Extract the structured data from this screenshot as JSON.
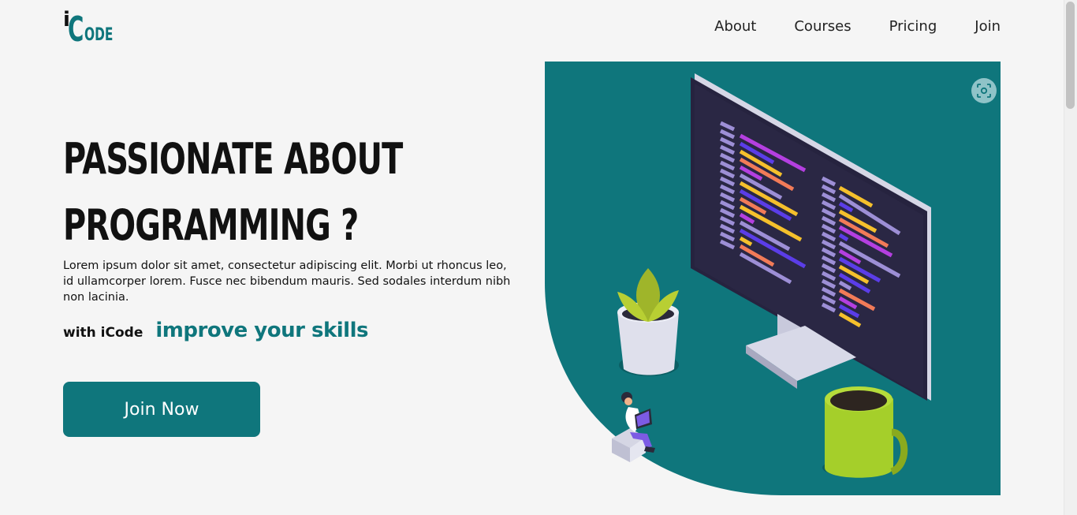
{
  "brand": {
    "logo_i": "i",
    "logo_c": "C",
    "logo_rest": "ODE",
    "accent": "#0f767c"
  },
  "nav": {
    "items": [
      "About",
      "Courses",
      "Pricing",
      "Join"
    ]
  },
  "hero": {
    "title_line1": "Passionate about",
    "title_line2": "programming ?",
    "description": "Lorem ipsum dolor sit amet, consectetur adipiscing elit. Morbi ut rhoncus leo, id ullamcorper lorem. Fusce nec bibendum mauris. Sed sodales interdum nibh non lacinia.",
    "with_label": "with iCode",
    "improve_label": "improve your skills",
    "cta_label": "Join Now"
  },
  "illustration": {
    "icon": "developer-desk-illustration",
    "lens_icon": "visual-search-icon"
  }
}
